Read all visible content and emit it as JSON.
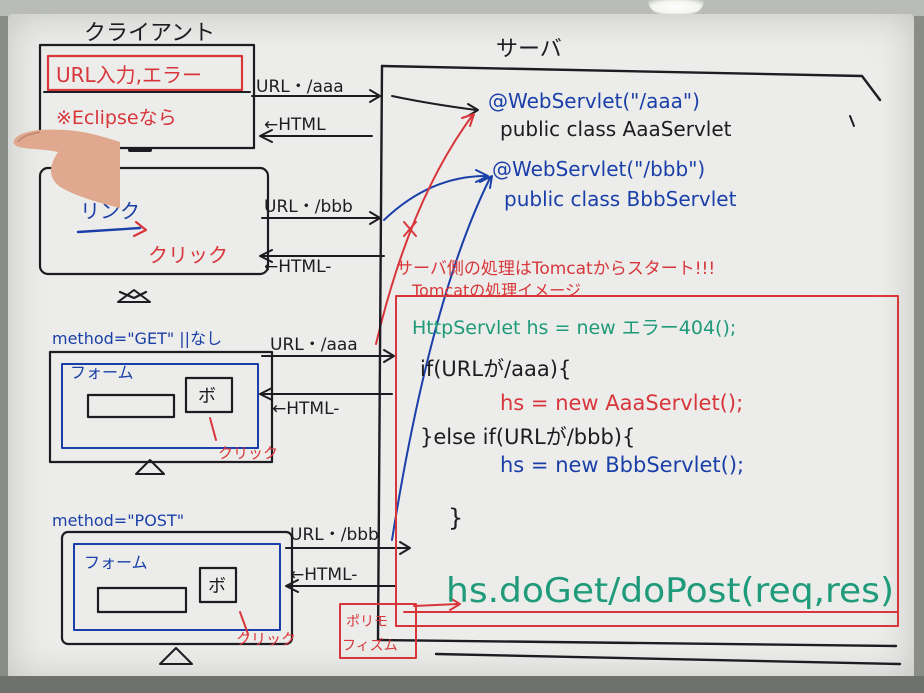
{
  "colors": {
    "blue": "#1a3fa8",
    "red": "#d8363b",
    "green": "#1f9a7a",
    "black": "#1c1c22",
    "skin": "#e0a98f"
  },
  "client": {
    "title": "クライアント",
    "box1_line1": "URL入力,エラー",
    "box1_line2": "※Eclipseなら",
    "box2_link": "リンク",
    "box2_click": "クリック",
    "get_method": "method=\"GET\" ||なし",
    "form_label1": "フォーム",
    "button1": "ボ",
    "click1": "クリック",
    "post_method": "method=\"POST\"",
    "form_label2": "フォーム",
    "button2": "ボ",
    "click2": "クリック"
  },
  "arrows": {
    "url_aaa_1": "URL・/aaa",
    "html_1": "←HTML",
    "url_bbb_1": "URL・/bbb",
    "html_2": "←HTML-",
    "url_aaa_2": "URL・/aaa",
    "html_3": "←HTML-",
    "url_bbb_2": "URL・/bbb",
    "html_4": "←HTML-"
  },
  "server": {
    "title": "サーバ",
    "anno1": "@WebServlet(\"/aaa\")",
    "class1": "public class AaaServlet",
    "anno2": "@WebServlet(\"/bbb\")",
    "class2": "public class BbbServlet",
    "note1": "サーバ側の処理はTomcatからスタート!!!",
    "note2": "Tomcatの処理イメージ",
    "code1": "HttpServlet hs = new エラー404();",
    "code2": "if(URLが/aaa){",
    "code3": "hs = new AaaServlet();",
    "code4": "}else if(URLが/bbb){",
    "code5": "hs = new BbbServlet();",
    "code6": "}",
    "code7": "hs.doGet/doPost(req,res)",
    "poly": [
      "ポリモ",
      "フィズム"
    ]
  }
}
